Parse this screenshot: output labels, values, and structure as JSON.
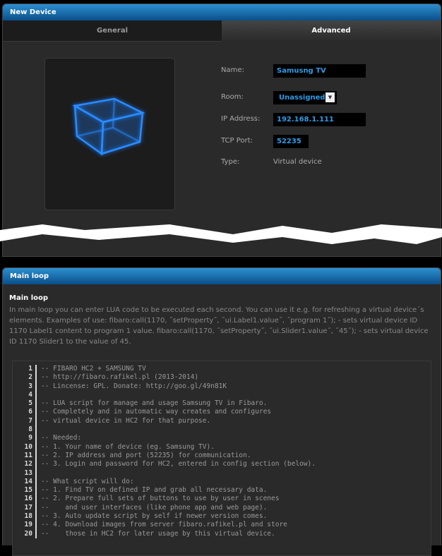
{
  "device_panel": {
    "title": "New Device",
    "tabs": [
      "General",
      "Advanced"
    ],
    "fields": {
      "name_label": "Name:",
      "name_value": "Samusng TV",
      "room_label": "Room:",
      "room_value": "Unassigned",
      "ip_label": "IP Address:",
      "ip_value": "192.168.1.111",
      "port_label": "TCP Port:",
      "port_value": "52235",
      "type_label": "Type:",
      "type_value": "Virtual device"
    },
    "icon": "3d-cube-icon"
  },
  "main_loop": {
    "title": "Main loop",
    "subtitle": "Main loop",
    "description": "In main loop you can enter LUA code to be executed each second. You can use it e.g. for refreshing a virtual device´s elements. Examples of use: fibaro:call(1170, ˝setProperty˝, ˝ui.Label1.value˝, ˝program 1˝); - sets virtual device ID 1170 Label1 content to program 1 value. fibaro:call(1170, ˝setProperty˝, ˝ui.Slider1.value˝, ˝45˝); - sets virtual device ID 1170 Slider1 to the value of 45.",
    "code_lines": [
      "-- FIBARO HC2 + SAMSUNG TV",
      "-- http://fibaro.rafikel.pl (2013-2014)",
      "-- Lincense: GPL. Donate: http://goo.gl/49n81K",
      "",
      "-- LUA script for manage and usage Samsung TV in Fibaro.",
      "-- Completely and in automatic way creates and configures",
      "-- virtual device in HC2 for that purpose.",
      "",
      "-- Needed:",
      "-- 1. Your name of device (eg. Samsung TV).",
      "-- 2. IP address and port (52235) for communication.",
      "-- 3. Login and password for HC2, entered in config section (below).",
      "",
      "-- What script will do:",
      "-- 1. Find TV on defined IP and grab all necessary data.",
      "-- 2. Prepare full sets of buttons to use by user in scenes",
      "--    and user interfaces (like phone app and web page).",
      "-- 3. Auto update script by self if newer version comes.",
      "-- 4. Download images from server fibaro.rafikel.pl and store",
      "--    those in HC2 for later usage by this virtual device."
    ]
  }
}
